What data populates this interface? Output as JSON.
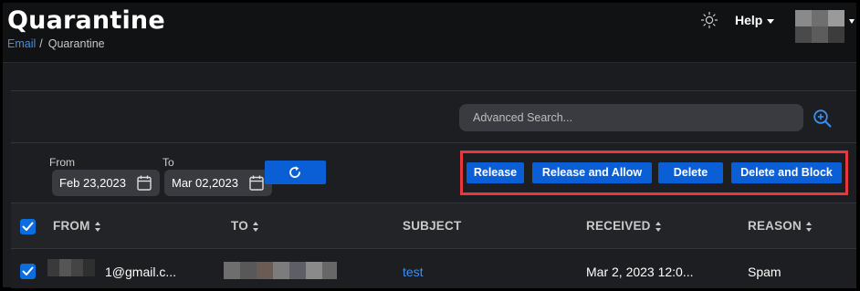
{
  "page": {
    "title": "Quarantine",
    "breadcrumb": {
      "link": "Email",
      "separator": "/",
      "current": "Quarantine"
    }
  },
  "header": {
    "theme_icon": "sun-icon",
    "help_label": "Help"
  },
  "search": {
    "placeholder": "Advanced Search...",
    "icon": "zoom-in-icon"
  },
  "filters": {
    "from_label": "From",
    "from_value": "Feb 23,2023",
    "to_label": "To",
    "to_value": "Mar 02,2023",
    "refresh_icon": "refresh-icon"
  },
  "actions": {
    "release": "Release",
    "release_allow": "Release and Allow",
    "delete": "Delete",
    "delete_block": "Delete and Block",
    "highlight_color": "#e8373f"
  },
  "table": {
    "columns": [
      "FROM",
      "TO",
      "SUBJECT",
      "RECEIVED",
      "REASON"
    ],
    "rows": [
      {
        "from": "1@gmail.c...",
        "to": "",
        "subject": "test",
        "received": "Mar 2, 2023 12:0...",
        "reason": "Spam"
      }
    ]
  },
  "colors": {
    "accent": "#0b5fd6",
    "link": "#3d8ef0",
    "background": "#1b1c1f"
  }
}
